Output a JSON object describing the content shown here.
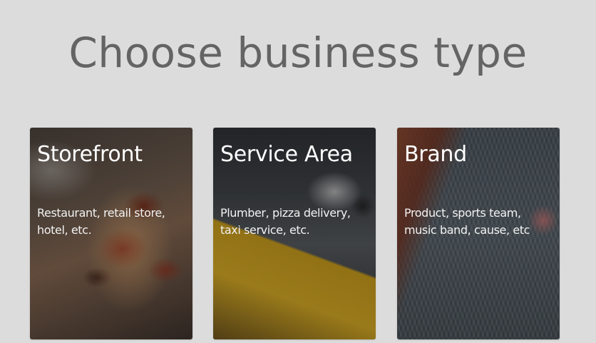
{
  "header": {
    "title": "Choose business type"
  },
  "cards": [
    {
      "title": "Storefront",
      "description": "Restaurant, retail store, hotel, etc."
    },
    {
      "title": "Service Area",
      "description": "Plumber, pizza delivery, taxi service, etc."
    },
    {
      "title": "Brand",
      "description": "Product, sports team, music band, cause, etc"
    }
  ]
}
